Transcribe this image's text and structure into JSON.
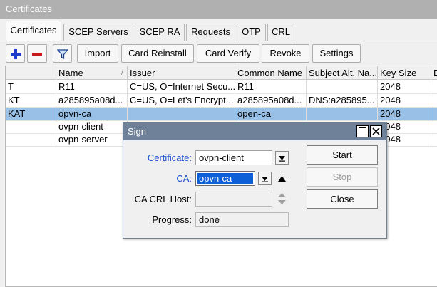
{
  "window": {
    "title": "Certificates"
  },
  "tabs": [
    {
      "label": "Certificates"
    },
    {
      "label": "SCEP Servers"
    },
    {
      "label": "SCEP RA"
    },
    {
      "label": "Requests"
    },
    {
      "label": "OTP"
    },
    {
      "label": "CRL"
    }
  ],
  "toolbar": {
    "import": "Import",
    "card_reinstall": "Card Reinstall",
    "card_verify": "Card Verify",
    "revoke": "Revoke",
    "settings": "Settings"
  },
  "table": {
    "columns": [
      "",
      "Name",
      "Issuer",
      "Common Name",
      "Subject Alt. Na...",
      "Key Size",
      "D"
    ],
    "rows": [
      {
        "flags": "T",
        "name": "R11",
        "issuer": "C=US, O=Internet Secu...",
        "common_name": "R11",
        "subject_alt": "",
        "key_size": "2048"
      },
      {
        "flags": "KT",
        "name": "a285895a08d...",
        "issuer": "C=US, O=Let's Encrypt...",
        "common_name": "a285895a08d...",
        "subject_alt": "DNS:a285895...",
        "key_size": "2048"
      },
      {
        "flags": "KAT",
        "name": "opvn-ca",
        "issuer": "",
        "common_name": "open-ca",
        "subject_alt": "",
        "key_size": "2048"
      },
      {
        "flags": "",
        "name": "ovpn-client",
        "issuer": "",
        "common_name": "",
        "subject_alt": "",
        "key_size": "2048"
      },
      {
        "flags": "",
        "name": "ovpn-server",
        "issuer": "",
        "common_name": "",
        "subject_alt": "",
        "key_size": "2048"
      }
    ]
  },
  "dialog": {
    "title": "Sign",
    "certificate_label": "Certificate:",
    "certificate_value": "ovpn-client",
    "ca_label": "CA:",
    "ca_value": "opvn-ca",
    "ca_crl_host_label": "CA CRL Host:",
    "ca_crl_host_value": "",
    "progress_label": "Progress:",
    "progress_value": "done",
    "start": "Start",
    "stop": "Stop",
    "close": "Close"
  },
  "colors": {
    "link_label": "#1f4fd0",
    "selected_row": "#99c1e8",
    "add_icon": "#1a3cc8",
    "remove_icon": "#c81a1a"
  }
}
